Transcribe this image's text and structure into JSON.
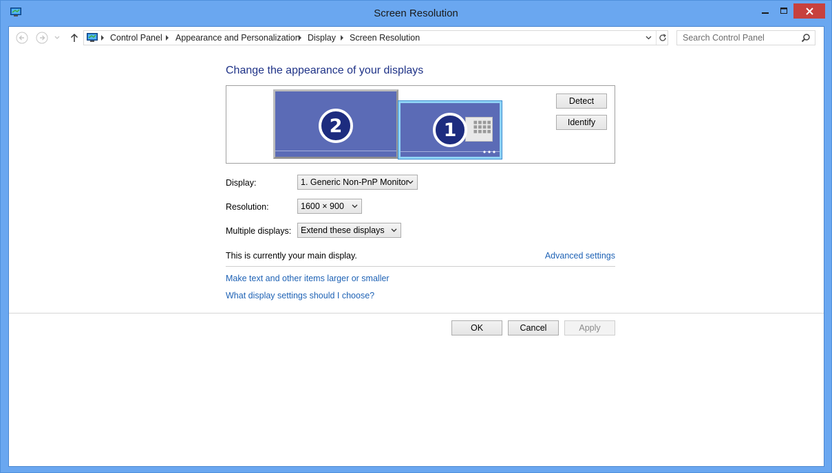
{
  "window": {
    "title": "Screen Resolution"
  },
  "colors": {
    "frame": "#6aa7f0",
    "close_button": "#c7413d",
    "link": "#1e62b5",
    "heading": "#1e3287",
    "monitor_fill": "#5b6bb6"
  },
  "icons": {
    "app": "control-panel-monitor-icon",
    "back": "back-arrow-icon",
    "forward": "forward-arrow-icon",
    "recent": "chevron-down-icon",
    "up": "up-arrow-icon",
    "search": "search-icon",
    "refresh": "refresh-icon"
  },
  "address_bar": {
    "crumbs": [
      "Control Panel",
      "Appearance and Personalization",
      "Display",
      "Screen Resolution"
    ]
  },
  "search": {
    "placeholder": "Search Control Panel"
  },
  "main": {
    "title": "Change the appearance of your displays",
    "monitors": {
      "secondary_number": "2",
      "primary_number": "1"
    },
    "detect_label": "Detect",
    "identify_label": "Identify",
    "fields": {
      "display_label": "Display:",
      "display_value": "1. Generic Non-PnP Monitor",
      "resolution_label": "Resolution:",
      "resolution_value": "1600 × 900",
      "multiple_label": "Multiple displays:",
      "multiple_value": "Extend these displays"
    },
    "main_display_text": "This is currently your main display.",
    "advanced_link": "Advanced settings",
    "larger_link": "Make text and other items larger or smaller",
    "choose_link": "What display settings should I choose?"
  },
  "footer": {
    "ok_label": "OK",
    "cancel_label": "Cancel",
    "apply_label": "Apply"
  }
}
